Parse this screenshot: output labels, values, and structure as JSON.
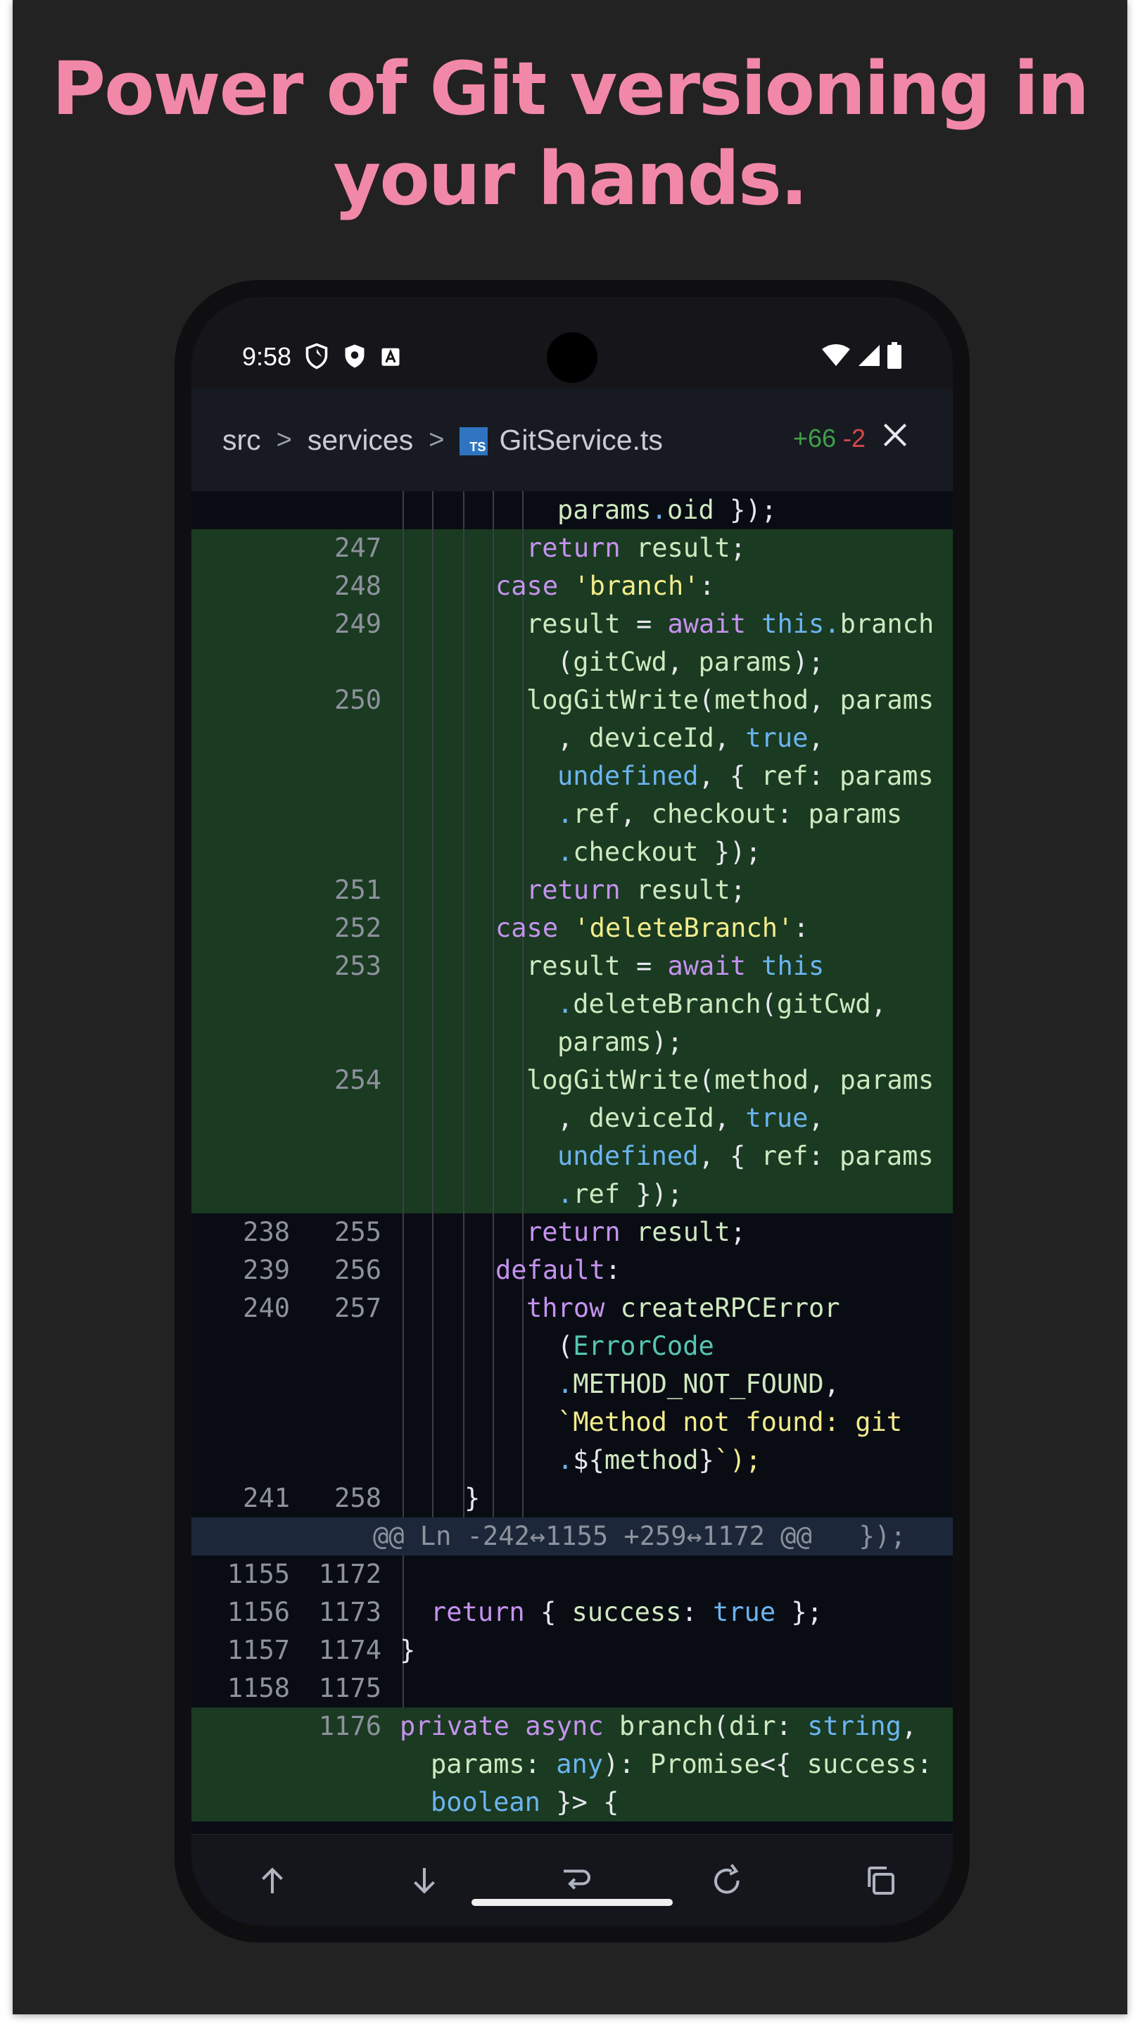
{
  "headline": {
    "line1": "Power of Git versioning in",
    "line2": "your hands."
  },
  "status_bar": {
    "time": "9:58",
    "left_icons": [
      "shield-outline-icon",
      "shield-filled-icon",
      "font-a-icon"
    ],
    "right_icons": [
      "wifi-icon",
      "cell-signal-icon",
      "battery-icon"
    ]
  },
  "header": {
    "breadcrumb": [
      "src",
      "services"
    ],
    "file_icon_label": "TS",
    "file_name": "GitService.ts",
    "additions": "+66",
    "deletions": "-2"
  },
  "diff_lines": [
    {
      "old": "",
      "new": "",
      "added": false,
      "text": "params.oid });"
    },
    {
      "old": "",
      "new": "247",
      "added": true,
      "text": "return result;"
    },
    {
      "old": "",
      "new": "248",
      "added": true,
      "text": "case 'branch':"
    },
    {
      "old": "",
      "new": "249",
      "added": true,
      "text": "result = await this.branch"
    },
    {
      "old": "",
      "new": "",
      "added": true,
      "text": "(gitCwd, params);"
    },
    {
      "old": "",
      "new": "250",
      "added": true,
      "text": "logGitWrite(method, params"
    },
    {
      "old": "",
      "new": "",
      "added": true,
      "text": ", deviceId, true,"
    },
    {
      "old": "",
      "new": "",
      "added": true,
      "text": "undefined, { ref: params"
    },
    {
      "old": "",
      "new": "",
      "added": true,
      "text": ".ref, checkout: params"
    },
    {
      "old": "",
      "new": "",
      "added": true,
      "text": ".checkout });"
    },
    {
      "old": "",
      "new": "251",
      "added": true,
      "text": "return result;"
    },
    {
      "old": "",
      "new": "252",
      "added": true,
      "text": "case 'deleteBranch':"
    },
    {
      "old": "",
      "new": "253",
      "added": true,
      "text": "result = await this"
    },
    {
      "old": "",
      "new": "",
      "added": true,
      "text": ".deleteBranch(gitCwd,"
    },
    {
      "old": "",
      "new": "",
      "added": true,
      "text": "params);"
    },
    {
      "old": "",
      "new": "254",
      "added": true,
      "text": "logGitWrite(method, params"
    },
    {
      "old": "",
      "new": "",
      "added": true,
      "text": ", deviceId, true,"
    },
    {
      "old": "",
      "new": "",
      "added": true,
      "text": "undefined, { ref: params"
    },
    {
      "old": "",
      "new": "",
      "added": true,
      "text": ".ref });"
    },
    {
      "old": "238",
      "new": "255",
      "added": false,
      "text": "return result;"
    },
    {
      "old": "239",
      "new": "256",
      "added": false,
      "text": "default:"
    },
    {
      "old": "240",
      "new": "257",
      "added": false,
      "text": "throw createRPCError"
    },
    {
      "old": "",
      "new": "",
      "added": false,
      "text": "(ErrorCode"
    },
    {
      "old": "",
      "new": "",
      "added": false,
      "text": ".METHOD_NOT_FOUND,"
    },
    {
      "old": "",
      "new": "",
      "added": false,
      "text": "`Method not found: git"
    },
    {
      "old": "",
      "new": "",
      "added": false,
      "text": ".${method}`);"
    },
    {
      "old": "241",
      "new": "258",
      "added": false,
      "text": "}"
    },
    {
      "old": "",
      "new": "",
      "added": false,
      "hunk": true,
      "text": "@@ Ln -242↔1155 +259↔1172 @@   });"
    },
    {
      "old": "1155",
      "new": "1172",
      "added": false,
      "text": ""
    },
    {
      "old": "1156",
      "new": "1173",
      "added": false,
      "text": "return { success: true };"
    },
    {
      "old": "1157",
      "new": "1174",
      "added": false,
      "text": "}"
    },
    {
      "old": "1158",
      "new": "1175",
      "added": false,
      "text": ""
    },
    {
      "old": "",
      "new": "1176",
      "added": true,
      "text": "private async branch(dir: string,"
    },
    {
      "old": "",
      "new": "",
      "added": true,
      "text": "params: any): Promise<{ success:"
    },
    {
      "old": "",
      "new": "",
      "added": true,
      "text": "boolean }> {"
    }
  ],
  "toolbar": {
    "buttons": [
      "arrow-up-icon",
      "arrow-down-icon",
      "wrap-lines-icon",
      "redo-icon",
      "copy-icon"
    ]
  },
  "colors": {
    "headline": "#f288a8",
    "added_bg": "#1a3a21",
    "hunk_bg": "#1c283a",
    "keyword": "#c592ef",
    "string": "#f2ec8a",
    "builtin": "#6cb4f0",
    "type": "#56c6b0"
  }
}
